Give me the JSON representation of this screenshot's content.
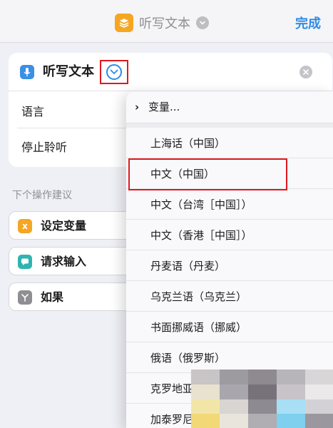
{
  "nav": {
    "title": "听写文本",
    "done_label": "完成"
  },
  "action": {
    "title": "听写文本",
    "params": [
      {
        "label": "语言"
      },
      {
        "label": "停止聆听"
      }
    ]
  },
  "suggestions": {
    "header": "下个操作建议",
    "items": [
      {
        "label": "设定变量",
        "icon_text": "x",
        "color": "#f5a623"
      },
      {
        "label": "请求输入",
        "color": "#2fb5b0"
      },
      {
        "label": "如果",
        "color": "#8e8e93"
      }
    ]
  },
  "menu": {
    "variables_label": "变量...",
    "languages": [
      "上海话（中国）",
      "中文（中国）",
      "中文（台湾［中国］）",
      "中文（香港［中国］）",
      "丹麦语（丹麦）",
      "乌克兰语（乌克兰）",
      "书面挪威语（挪威）",
      "俄语（俄罗斯）",
      "克罗地亚语（克罗地亚）",
      "加泰罗尼亚语（西班牙）"
    ],
    "selected_index": 1
  },
  "colors": {
    "accent": "#2d8ce6",
    "highlight": "#e0191e"
  }
}
